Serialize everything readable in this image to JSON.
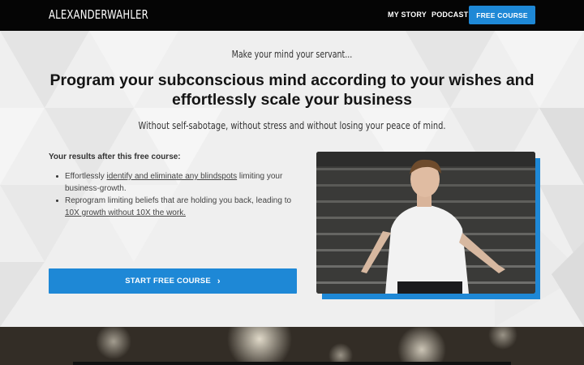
{
  "nav": {
    "logo": "ALEXANDERWAHLER",
    "links": [
      "MY STORY",
      "PODCAST"
    ],
    "cta": "FREE COURSE"
  },
  "hero": {
    "tagline": "Make your mind your servant...",
    "headline": "Program your subconscious mind according to your wishes and effortlessly scale your business",
    "subline": "Without self-sabotage, without stress and without losing your peace of mind.",
    "results_title": "Your results after this free course:",
    "bullet1": {
      "pre": "Effortlessly ",
      "link": "identify and eliminate any blindspots",
      "post": " limiting your business-growth."
    },
    "bullet2": {
      "pre": "Reprogram limiting beliefs that are holding you back, leading to ",
      "link": "10X growth without 10X the work."
    },
    "cta": "START FREE COURSE",
    "cta_icon": "chevron-right-icon"
  },
  "colors": {
    "accent": "#1e88d6",
    "navbar": "#050505"
  }
}
